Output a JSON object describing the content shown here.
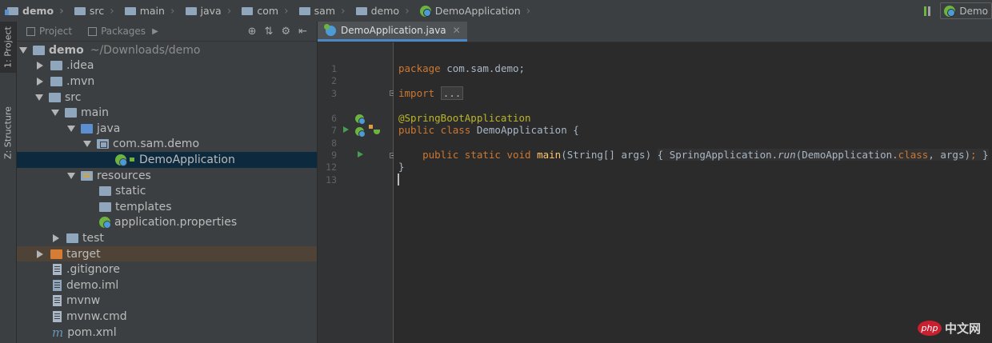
{
  "breadcrumbs": [
    {
      "label": "demo",
      "kind": "module"
    },
    {
      "label": "src",
      "kind": "folder"
    },
    {
      "label": "main",
      "kind": "folder"
    },
    {
      "label": "java",
      "kind": "folder"
    },
    {
      "label": "com",
      "kind": "folder"
    },
    {
      "label": "sam",
      "kind": "folder"
    },
    {
      "label": "demo",
      "kind": "folder"
    },
    {
      "label": "DemoApplication",
      "kind": "spring-class"
    }
  ],
  "run_config": {
    "label": "Demo"
  },
  "left_stripe": {
    "project_tab": "1: Project",
    "structure_tab": "Z: Structure"
  },
  "project_panel": {
    "tab_project": "Project",
    "tab_packages": "Packages",
    "tree": [
      {
        "label": "demo",
        "hint": "~/Downloads/demo",
        "depth": 0,
        "arrow": "down",
        "icon": "module-folder",
        "bold": true
      },
      {
        "label": ".idea",
        "depth": 1,
        "arrow": "right",
        "icon": "folder"
      },
      {
        "label": ".mvn",
        "depth": 1,
        "arrow": "right",
        "icon": "folder"
      },
      {
        "label": "src",
        "depth": 1,
        "arrow": "down",
        "icon": "folder"
      },
      {
        "label": "main",
        "depth": 2,
        "arrow": "down",
        "icon": "folder"
      },
      {
        "label": "java",
        "depth": 3,
        "arrow": "down",
        "icon": "source-folder"
      },
      {
        "label": "com.sam.demo",
        "depth": 4,
        "arrow": "down",
        "icon": "package"
      },
      {
        "label": "DemoApplication",
        "depth": 5,
        "arrow": "none",
        "icon": "spring-class",
        "selected": true
      },
      {
        "label": "resources",
        "depth": 3,
        "arrow": "down",
        "icon": "resources-folder"
      },
      {
        "label": "static",
        "depth": 4,
        "arrow": "none",
        "icon": "folder"
      },
      {
        "label": "templates",
        "depth": 4,
        "arrow": "none",
        "icon": "folder"
      },
      {
        "label": "application.properties",
        "depth": 4,
        "arrow": "none",
        "icon": "spring-properties"
      },
      {
        "label": "test",
        "depth": 2,
        "arrow": "right",
        "icon": "folder"
      },
      {
        "label": "target",
        "depth": 1,
        "arrow": "right",
        "icon": "excluded-folder",
        "excluded": true
      },
      {
        "label": ".gitignore",
        "depth": 1,
        "arrow": "none",
        "icon": "file"
      },
      {
        "label": "demo.iml",
        "depth": 1,
        "arrow": "none",
        "icon": "iml-file"
      },
      {
        "label": "mvnw",
        "depth": 1,
        "arrow": "none",
        "icon": "file"
      },
      {
        "label": "mvnw.cmd",
        "depth": 1,
        "arrow": "none",
        "icon": "file"
      },
      {
        "label": "pom.xml",
        "depth": 1,
        "arrow": "none",
        "icon": "maven-file"
      }
    ]
  },
  "editor": {
    "tab_label": "DemoApplication.java",
    "line_numbers": [
      "1",
      "2",
      "3",
      "6",
      "7",
      "8",
      "9",
      "12",
      "13"
    ],
    "code": {
      "l1_kw": "package",
      "l1_rest": " com.sam.demo;",
      "l3_kw": "import",
      "l3_fold": "...",
      "l6_ann": "@SpringBootApplication",
      "l7_kw": "public class",
      "l7_rest": " DemoApplication {",
      "l9_kw": "public static void",
      "l9_method": "main",
      "l9_a": "(String[] args) ",
      "l9_b": "{ SpringApplication.",
      "l9_run": "run",
      "l9_c": "(DemoApplication.",
      "l9_class": "class",
      ", ": "",
      "l9_d": ", args)",
      "l9_semi": ";",
      "l9_e": " }",
      "l12": "}"
    }
  },
  "watermark": {
    "badge": "php",
    "text": "中文网"
  },
  "colors": {
    "keyword": "#cc7832",
    "annotation": "#bbb529",
    "method": "#ffc66d",
    "selection": "#0d293e",
    "excluded": "#4e4336"
  }
}
